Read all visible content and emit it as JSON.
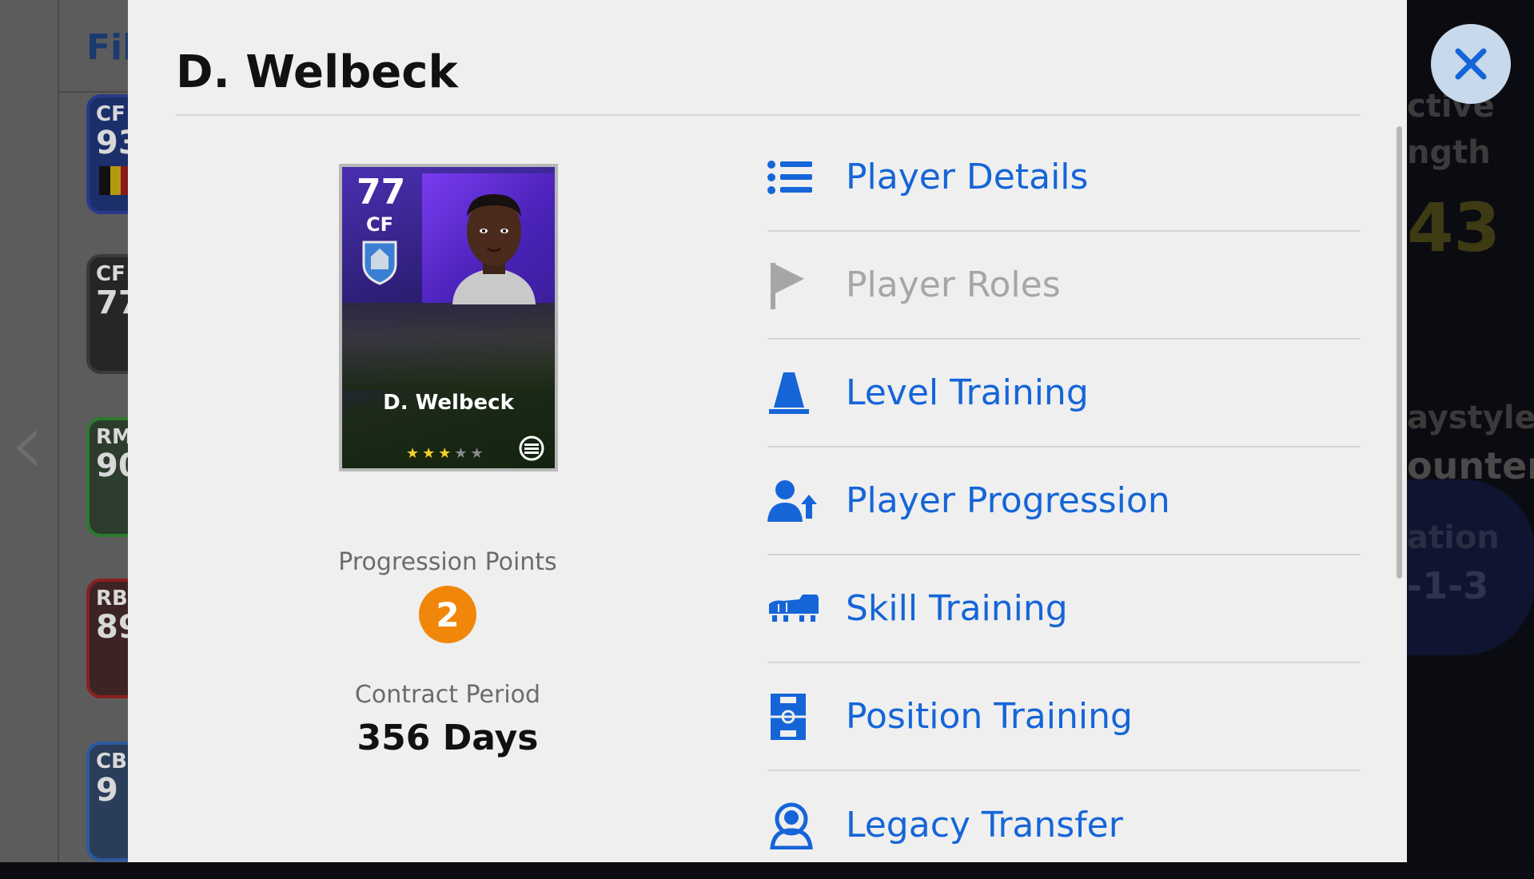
{
  "background": {
    "filter_label": "Fil",
    "mini_cards": [
      {
        "pos": "CF",
        "ovr": "93"
      },
      {
        "pos": "CF",
        "ovr": "77"
      },
      {
        "pos": "RM",
        "ovr": "90"
      },
      {
        "pos": "RB",
        "ovr": "89"
      },
      {
        "pos": "CB",
        "ovr": "9"
      }
    ],
    "right_texts": [
      "ctive",
      "ngth",
      "43",
      "aystyle",
      "ounter",
      "ation",
      "-1-3"
    ]
  },
  "modal": {
    "title": "D. Welbeck",
    "card": {
      "overall": "77",
      "position": "CF",
      "name": "D. Welbeck",
      "stars_filled": 3,
      "stars_total": 5
    },
    "progression": {
      "label": "Progression Points",
      "value": "2"
    },
    "contract": {
      "label": "Contract Period",
      "value": "356 Days"
    },
    "menu": [
      {
        "label": "Player Details",
        "icon": "list-icon",
        "enabled": true
      },
      {
        "label": "Player Roles",
        "icon": "flag-icon",
        "enabled": false
      },
      {
        "label": "Level Training",
        "icon": "cone-icon",
        "enabled": true
      },
      {
        "label": "Player Progression",
        "icon": "person-arrow-up-icon",
        "enabled": true
      },
      {
        "label": "Skill Training",
        "icon": "boot-icon",
        "enabled": true
      },
      {
        "label": "Position Training",
        "icon": "pitch-icon",
        "enabled": true
      },
      {
        "label": "Legacy Transfer",
        "icon": "person-badge-icon",
        "enabled": true
      }
    ],
    "colors": {
      "accent": "#1565d8",
      "disabled": "#a6a6a6",
      "badge": "#f0870a",
      "close_bg": "#c7d9ea"
    }
  }
}
